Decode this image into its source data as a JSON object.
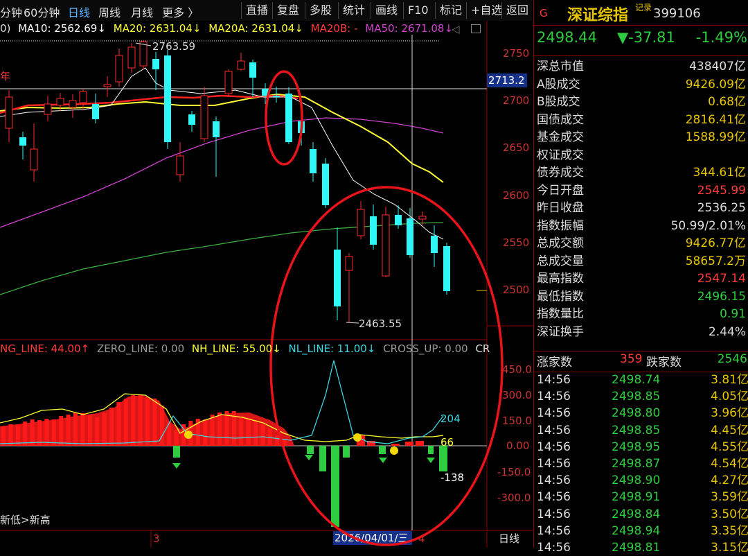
{
  "toolbar": {
    "tabs": [
      "分钟",
      "60分钟",
      "日线",
      "周线",
      "月线",
      "更多 〉"
    ],
    "buttons": [
      "直播",
      "复盘",
      "多股",
      "统计",
      "画线",
      "F10",
      "标记",
      "+自选",
      "返回"
    ]
  },
  "ma_line": {
    "prefix": "0)",
    "ma10": "MA10: 2562.69↓",
    "ma20": "MA20: 2631.04↓",
    "ma20a": "MA20A: 2631.04↓",
    "ma20b": "MA20B: -",
    "ma50": "MA50: 2671.08↓"
  },
  "price_chart": {
    "high_label": "2763.59",
    "low_label": "2463.55",
    "year_mark": "年",
    "current_price_tag": "2713.2",
    "y_ticks": [
      "2750",
      "2700",
      "2650",
      "2600",
      "2550",
      "2500"
    ]
  },
  "indicator": {
    "labels": {
      "ng_line": "NG_LINE: 44.00↑",
      "zero_line": "ZERO_LINE: 0.00",
      "nh_line": "NH_LINE: 55.00↓",
      "nl_line": "NL_LINE: 11.00↓",
      "cross_up": "CROSS_UP: 0.00",
      "cr": "CR"
    },
    "y_ticks": [
      "450.0",
      "300.0",
      "150.0",
      "0.00",
      "-150.0",
      "-300.0"
    ],
    "value_204": "204",
    "value_66": "66",
    "value_neg138": "-138",
    "bottom_note": "新低>新高"
  },
  "x_axis": {
    "mark_3": "3",
    "mark_4": "4",
    "date_tag": "2026/04/01/三",
    "period": "日线"
  },
  "right_panel": {
    "code_flag": "G",
    "name": "深证综指",
    "record": "记录",
    "code": "399106",
    "price": "2498.44",
    "change": "▼-37.81",
    "change_pct": "-1.49%",
    "rows": [
      {
        "label": "深总市值",
        "value": "438407亿",
        "color": "#dddddd"
      },
      {
        "label": "A股成交",
        "value": "9426.09亿",
        "color": "#e7c500"
      },
      {
        "label": "B股成交",
        "value": "0.68亿",
        "color": "#e7c500"
      },
      {
        "label": "国债成交",
        "value": "2816.41亿",
        "color": "#e7c500"
      },
      {
        "label": "基金成交",
        "value": "1588.99亿",
        "color": "#e7c500"
      },
      {
        "label": "权证成交",
        "value": "",
        "color": "#e7c500"
      },
      {
        "label": "债券成交",
        "value": "344.61亿",
        "color": "#e7c500"
      },
      {
        "label": "今日开盘",
        "value": "2545.99",
        "color": "#ff3b3b"
      },
      {
        "label": "昨日收盘",
        "value": "2536.25",
        "color": "#dddddd"
      },
      {
        "label": "指数振幅",
        "value": "50.99/2.01%",
        "color": "#dddddd"
      },
      {
        "label": "总成交额",
        "value": "9426.77亿",
        "color": "#e7c500"
      },
      {
        "label": "总成交量",
        "value": "58657.2万",
        "color": "#e7c500"
      },
      {
        "label": "最高指数",
        "value": "2547.14",
        "color": "#ff3b3b"
      },
      {
        "label": "最低指数",
        "value": "2496.15",
        "color": "#2ecc40"
      },
      {
        "label": "指数量比",
        "value": "0.91",
        "color": "#2ecc40"
      },
      {
        "label": "深证换手",
        "value": "2.44%",
        "color": "#dddddd"
      }
    ],
    "breadth": {
      "up_label": "涨家数",
      "up_value": "359",
      "down_label": "跌家数",
      "down_value": "2546"
    },
    "ticks": [
      {
        "time": "14:56",
        "price": "2498.74",
        "vol": "3.81亿"
      },
      {
        "time": "14:56",
        "price": "2498.85",
        "vol": "4.05亿"
      },
      {
        "time": "14:56",
        "price": "2498.80",
        "vol": "3.96亿"
      },
      {
        "time": "14:56",
        "price": "2498.85",
        "vol": "4.45亿"
      },
      {
        "time": "14:56",
        "price": "2498.95",
        "vol": "4.55亿"
      },
      {
        "time": "14:56",
        "price": "2498.87",
        "vol": "4.54亿"
      },
      {
        "time": "14:56",
        "price": "2498.90",
        "vol": "4.27亿"
      },
      {
        "time": "14:56",
        "price": "2498.91",
        "vol": "3.59亿"
      },
      {
        "time": "14:56",
        "price": "2498.84",
        "vol": "3.50亿"
      },
      {
        "time": "14:56",
        "price": "2498.94",
        "vol": "3.35亿"
      },
      {
        "time": "14:56",
        "price": "2498.81",
        "vol": "3.15亿"
      }
    ]
  },
  "colors": {
    "up": "#ff2a2a",
    "down": "#2ff7f7",
    "green": "#2ecc40",
    "yellow": "#e7c500",
    "ma_white": "#ffffff",
    "ma_yellow": "#ffff33",
    "ma_magenta": "#d042d0",
    "ma_green": "#3cb043",
    "circle": "#e8141a"
  }
}
